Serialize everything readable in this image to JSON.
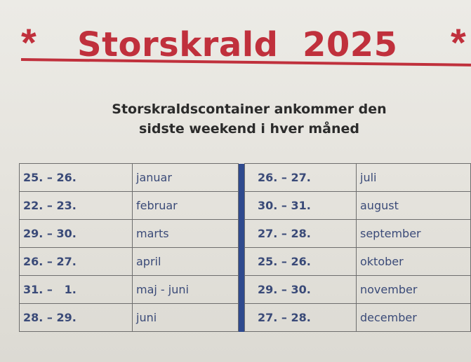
{
  "title": "Storskrald  2025",
  "star": "*",
  "subtitle_lines": [
    "Storskraldscontainer ankommer den",
    "sidste weekend i hver måned"
  ],
  "left": [
    {
      "date": "25. – 26.",
      "month": "januar"
    },
    {
      "date": "22. – 23.",
      "month": "februar"
    },
    {
      "date": "29. – 30.",
      "month": "marts"
    },
    {
      "date": "26. – 27.",
      "month": "april"
    },
    {
      "date": "31. –   1.",
      "month": "maj - juni"
    },
    {
      "date": "28. – 29.",
      "month": "juni"
    }
  ],
  "right": [
    {
      "date": "26. – 27.",
      "month": "juli"
    },
    {
      "date": "30. – 31.",
      "month": "august"
    },
    {
      "date": "27. – 28.",
      "month": "september"
    },
    {
      "date": "25. – 26.",
      "month": "oktober"
    },
    {
      "date": "29. – 30.",
      "month": "november"
    },
    {
      "date": "27. – 28.",
      "month": "december"
    }
  ],
  "colors": {
    "title": "#c0303c",
    "table_text": "#3a4a78",
    "separator": "#2f4a8e"
  }
}
